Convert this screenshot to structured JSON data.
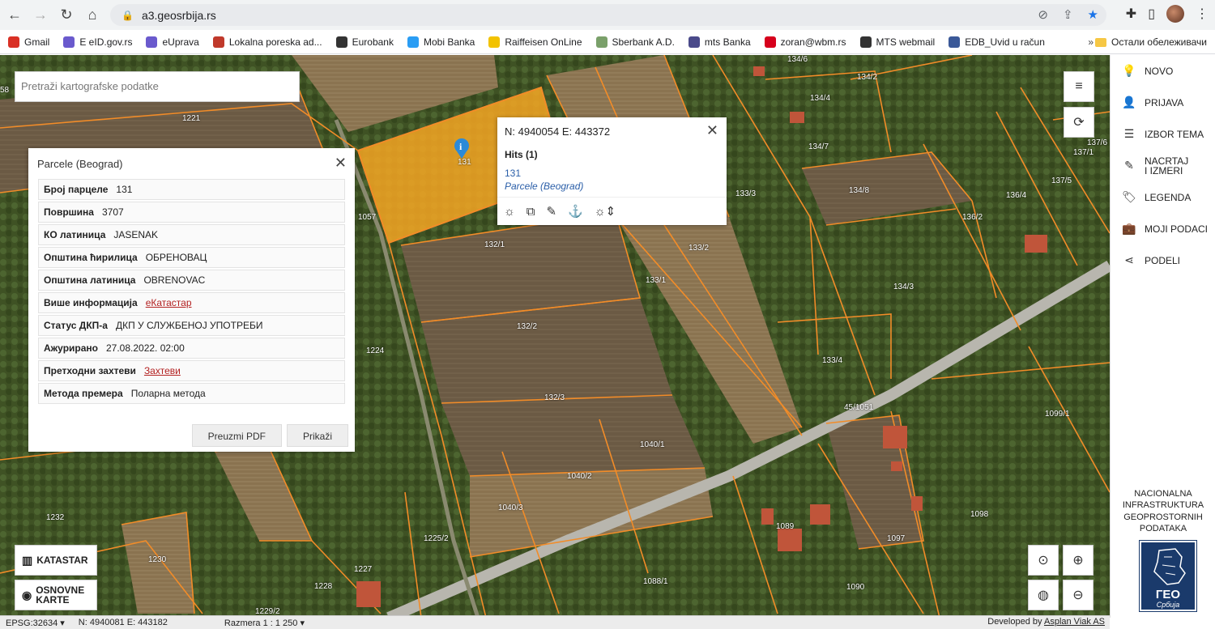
{
  "browser": {
    "url": "a3.geosrbija.rs",
    "bookmarks": [
      {
        "label": "Gmail",
        "color": "#d93025"
      },
      {
        "label": "E eID.gov.rs",
        "color": "#6a5acd"
      },
      {
        "label": "eUprava",
        "color": "#6a5acd"
      },
      {
        "label": "Lokalna poreska ad...",
        "color": "#c0392b"
      },
      {
        "label": "Eurobank",
        "color": "#333333"
      },
      {
        "label": "Mobi Banka",
        "color": "#2a9df4"
      },
      {
        "label": "Raiffeisen OnLine",
        "color": "#f2c200"
      },
      {
        "label": "Sberbank A.D.",
        "color": "#7aa06a"
      },
      {
        "label": "mts Banka",
        "color": "#4a4a8a"
      },
      {
        "label": "zoran@wbm.rs",
        "color": "#d6001c"
      },
      {
        "label": "MTS webmail",
        "color": "#333333"
      },
      {
        "label": "EDB_Uvid u račun",
        "color": "#3b5998"
      }
    ],
    "bookmarks_more": "»",
    "other_bookmarks": "Остали обележивачи"
  },
  "search": {
    "placeholder": "Pretraži kartografske podatke"
  },
  "panel": {
    "title": "Parcele (Beograd)",
    "rows": [
      {
        "key": "Број парцеле",
        "value": "131"
      },
      {
        "key": "Површина",
        "value": "3707"
      },
      {
        "key": "КО латиница",
        "value": "JASENAK"
      },
      {
        "key": "Општина ћирилица",
        "value": "ОБРЕНОВАЦ"
      },
      {
        "key": "Општина латиница",
        "value": "OBRENOVAC"
      },
      {
        "key": "Више информација",
        "value": "еКатастар",
        "link": true
      },
      {
        "key": "Статус ДКП-а",
        "value": "ДКП У СЛУЖБЕНОЈ УПОТРЕБИ"
      },
      {
        "key": "Ажурирано",
        "value": "27.08.2022. 02:00"
      },
      {
        "key": "Претходни захтеви",
        "value": "Захтеви",
        "link": true
      },
      {
        "key": "Метода премера",
        "value": "Поларна метода"
      }
    ],
    "btn_pdf": "Preuzmi PDF",
    "btn_show": "Prikaži"
  },
  "popup": {
    "coords": "N: 4940054 E: 443372",
    "hits": "Hits (1)",
    "hit_number": "131",
    "hit_layer": "Parcele (Beograd)"
  },
  "map_labels": [
    {
      "t": "1221"
    },
    {
      "t": "131"
    },
    {
      "t": "1057"
    },
    {
      "t": "132/1"
    },
    {
      "t": "132/2"
    },
    {
      "t": "132/3"
    },
    {
      "t": "133/1"
    },
    {
      "t": "133/2"
    },
    {
      "t": "133/3"
    },
    {
      "t": "133/4"
    },
    {
      "t": "134/2"
    },
    {
      "t": "134/4"
    },
    {
      "t": "134/6"
    },
    {
      "t": "134/7"
    },
    {
      "t": "134/8"
    },
    {
      "t": "134/3"
    },
    {
      "t": "136/2"
    },
    {
      "t": "136/4"
    },
    {
      "t": "137/1"
    },
    {
      "t": "137/5"
    },
    {
      "t": "137/6"
    },
    {
      "t": "1224"
    },
    {
      "t": "1040/1"
    },
    {
      "t": "1040/2"
    },
    {
      "t": "1040/3"
    },
    {
      "t": "1225/2"
    },
    {
      "t": "1227"
    },
    {
      "t": "1228"
    },
    {
      "t": "1229/2"
    },
    {
      "t": "1230"
    },
    {
      "t": "1232"
    },
    {
      "t": "1088/1"
    },
    {
      "t": "1089"
    },
    {
      "t": "1090"
    },
    {
      "t": "1097"
    },
    {
      "t": "1098"
    },
    {
      "t": "1099/1"
    },
    {
      "t": "45/1051"
    },
    {
      "t": "58"
    }
  ],
  "buttons": {
    "katastar": "KATASTAR",
    "osnovne_karte": "OSNOVNE KARTE"
  },
  "sidebar": {
    "items": [
      {
        "label": "NOVO",
        "icon": "lightbulb-icon"
      },
      {
        "label": "PRIJAVA",
        "icon": "user-icon"
      },
      {
        "label": "IZBOR TEMA",
        "icon": "layers-icon"
      },
      {
        "label": "NACRTAJ I IZMERI",
        "icon": "pencil-icon"
      },
      {
        "label": "LEGENDA",
        "icon": "tag-icon"
      },
      {
        "label": "MOJI PODACI",
        "icon": "briefcase-icon"
      },
      {
        "label": "PODELI",
        "icon": "share-icon"
      }
    ],
    "nipp": "NACIONALNA INFRASTRUKTURA GEOPROSTORNIH PODATAKA",
    "logo_text": "ГЕО",
    "logo_sub": "Србија"
  },
  "status": {
    "epsg": "EPSG:32634 ▾",
    "coords": "N: 4940081 E: 443182",
    "scale": "Razmera 1 : 1 250 ▾",
    "developed": "Developed by",
    "developer": "Asplan Viak AS"
  },
  "colors": {
    "parcel_line": "#f28c28",
    "selected_fill": "#f5a623"
  }
}
